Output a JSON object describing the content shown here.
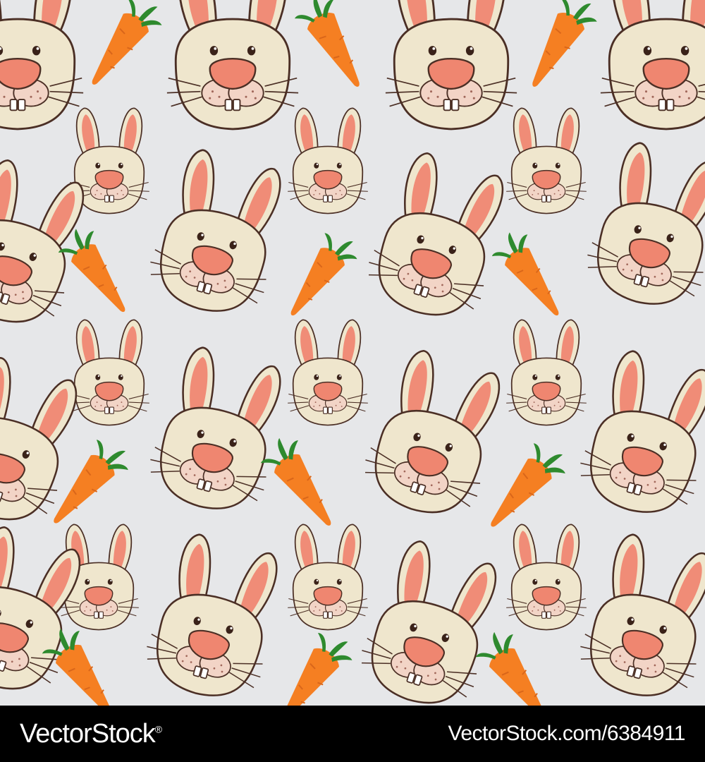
{
  "watermark": {
    "brand": "VectorStock",
    "registered_mark": "®",
    "stock_id": "VectorStock.com/6384911"
  },
  "colors": {
    "background": "#e6e7e9",
    "bunny_face": "#efe6cd",
    "bunny_outline": "#4b2f25",
    "inner_ear": "#f08c77",
    "nose": "#ef8670",
    "muzzle": "#f2d4c6",
    "teeth": "#ffffff",
    "carrot": "#f57f22",
    "carrot_leaf": "#2e8a2e",
    "watermark_bar": "#000000",
    "watermark_text": "#ffffff"
  },
  "icons": [
    "bunny-face-icon",
    "carrot-icon"
  ]
}
